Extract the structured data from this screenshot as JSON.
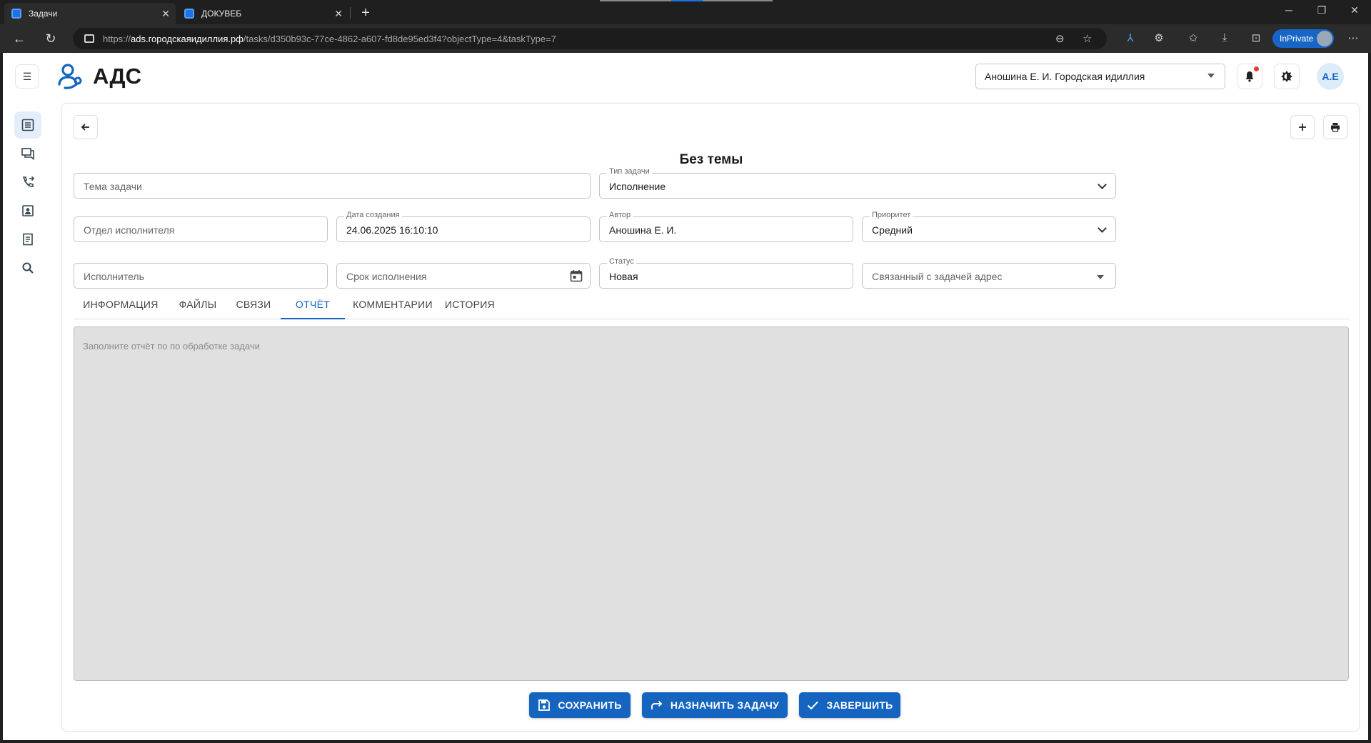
{
  "browser": {
    "tabs": [
      {
        "title": "Задачи",
        "active": true
      },
      {
        "title": "ДОКУВЕБ",
        "active": false
      }
    ],
    "url_prefix": "https://",
    "url_host": "ads.городскаяидиллия.рф",
    "url_path": "/tasks/d350b93c-77ce-4862-a607-fd8de95ed3f4?objectType=4&taskType=7",
    "inprivate_label": "InPrivate"
  },
  "header": {
    "app_title": "АДС",
    "org_select_value": "Аношина Е. И. Городская идиллия",
    "avatar_initials": "А.Е",
    "brand_color": "#1565c0"
  },
  "sidebar": {
    "items": [
      {
        "icon": "task-list-icon",
        "active": true
      },
      {
        "icon": "chat-icon",
        "active": false
      },
      {
        "icon": "call-forward-icon",
        "active": false
      },
      {
        "icon": "contact-card-icon",
        "active": false
      },
      {
        "icon": "document-icon",
        "active": false
      },
      {
        "icon": "search-icon",
        "active": false
      }
    ]
  },
  "task": {
    "title": "Без темы",
    "fields": {
      "subject": {
        "label": "",
        "placeholder": "Тема задачи",
        "value": ""
      },
      "task_type": {
        "label": "Тип задачи",
        "value": "Исполнение"
      },
      "department": {
        "label": "",
        "placeholder": "Отдел исполнителя",
        "value": ""
      },
      "created_at": {
        "label": "Дата создания",
        "value": "24.06.2025 16:10:10"
      },
      "author": {
        "label": "Автор",
        "value": "Аношина Е. И."
      },
      "priority": {
        "label": "Приоритет",
        "value": "Средний"
      },
      "executor": {
        "label": "",
        "placeholder": "Исполнитель",
        "value": ""
      },
      "deadline": {
        "label": "",
        "placeholder": "Срок исполнения",
        "value": ""
      },
      "status": {
        "label": "Статус",
        "value": "Новая"
      },
      "address": {
        "label": "",
        "placeholder": "Связанный с задачей адрес",
        "value": ""
      }
    },
    "tabs": [
      {
        "label": "ИНФОРМАЦИЯ",
        "active": false
      },
      {
        "label": "ФАЙЛЫ",
        "active": false
      },
      {
        "label": "СВЯЗИ",
        "active": false
      },
      {
        "label": "ОТЧЁТ",
        "active": true
      },
      {
        "label": "КОММЕНТАРИИ",
        "active": false
      },
      {
        "label": "ИСТОРИЯ",
        "active": false
      }
    ],
    "report_placeholder": "Заполните отчёт по по обработке задачи",
    "actions": {
      "save": "СОХРАНИТЬ",
      "assign": "НАЗНАЧИТЬ ЗАДАЧУ",
      "finish": "ЗАВЕРШИТЬ"
    }
  }
}
